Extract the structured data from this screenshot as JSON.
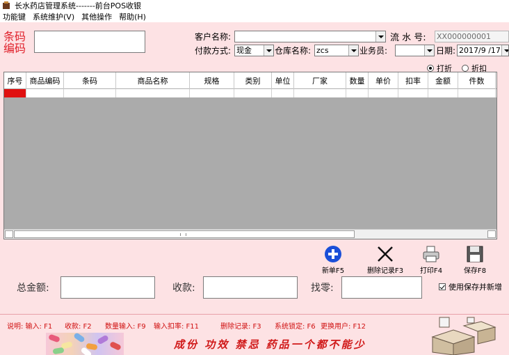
{
  "window": {
    "title": "长水药店管理系统-------前台POS收银"
  },
  "menu": [
    "功能键",
    "系统维护(V)",
    "其他操作",
    "帮助(H)"
  ],
  "barcode": {
    "label_line1": "条码",
    "label_line2": "编码",
    "value": ""
  },
  "form": {
    "customer_label": "客户名称:",
    "customer_value": "",
    "serial_label": "流 水 号:",
    "serial_value": "XX000000001",
    "payment_label": "付款方式:",
    "payment_value": "现金",
    "warehouse_label": "仓库名称:",
    "warehouse_value": "zcs",
    "salesperson_label": "业务员:",
    "salesperson_value": "",
    "date_label": "日期:",
    "date_value": "2017/9 /17"
  },
  "discount_options": [
    {
      "label": "打折",
      "selected": true
    },
    {
      "label": "折扣",
      "selected": false
    }
  ],
  "table": {
    "columns": [
      "序号",
      "商品编码",
      "条码",
      "商品名称",
      "规格",
      "类别",
      "单位",
      "厂家",
      "数量",
      "单价",
      "扣率",
      "金额",
      "件数"
    ],
    "rows": []
  },
  "toolbar": [
    {
      "label": "新单F5",
      "icon": "plus-circle-icon"
    },
    {
      "label": "删除记录F3",
      "icon": "x-icon"
    },
    {
      "label": "打印F4",
      "icon": "printer-icon"
    },
    {
      "label": "保存F8",
      "icon": "floppy-icon"
    }
  ],
  "totals": {
    "total_label": "总金额:",
    "received_label": "收款:",
    "change_label": "找零:",
    "total_value": "",
    "received_value": "",
    "change_value": ""
  },
  "save_checkbox": {
    "label": "使用保存并新增",
    "checked": true
  },
  "help": {
    "intro": "说明: 输入: F1",
    "receive": "收款: F2",
    "qty_input": "数量输入: F9",
    "discount_input": "输入扣率: F11",
    "delete": "删除记录: F3",
    "lock": "系统锁定: F6",
    "switch_user": "更换用户: F12"
  },
  "slogan": "成份  功效  禁忌  药品一个都不能少",
  "colors": {
    "background": "#fde2e4",
    "accent_red": "#e0202a",
    "grid_bg": "#ababab",
    "icon_blue": "#1a4fd8"
  }
}
